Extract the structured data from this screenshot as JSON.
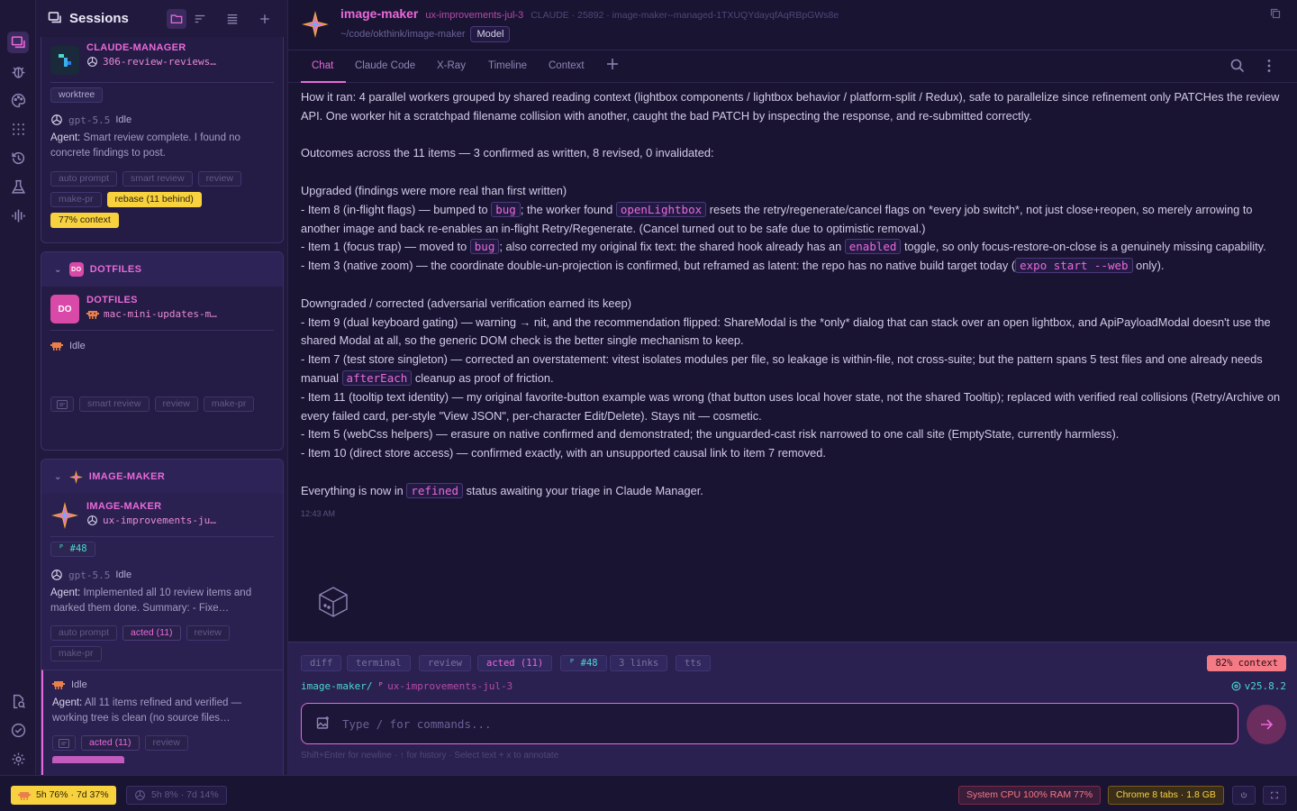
{
  "sidebar": {
    "title": "Sessions",
    "group_partial": {
      "project": "CLAUDE-MANAGER",
      "branch": "306-review-reviews…",
      "tag": "worktree",
      "model": "gpt-5.5",
      "status": "Idle",
      "agent_label": "Agent:",
      "agent_text": "Smart review complete. I found no concrete findings to post.",
      "chips": [
        "auto prompt",
        "smart review",
        "review",
        "make-pr"
      ],
      "rebase": "rebase (11 behind)",
      "context": "77% context"
    },
    "group_dotfiles": {
      "header": "DOTFILES",
      "badge": "DO",
      "project": "DOTFILES",
      "branch": "mac-mini-updates-m…",
      "status": "Idle",
      "chips": [
        "smart review",
        "review",
        "make-pr"
      ]
    },
    "group_image": {
      "header": "IMAGE-MAKER",
      "project": "IMAGE-MAKER",
      "branch": "ux-improvements-ju…",
      "pr": "#48",
      "model": "gpt-5.5",
      "status": "Idle",
      "agent_label": "Agent:",
      "agent_text": "Implemented all 10 review items and marked them done. Summary: - Fixe…",
      "chips": [
        "auto prompt",
        "acted (11)",
        "review",
        "make-pr"
      ],
      "sub_status": "Idle",
      "sub_agent_label": "Agent:",
      "sub_agent_text": "All 11 items refined and verified — working tree is clean (no source files…",
      "sub_chips": [
        "acted (11)",
        "review"
      ]
    }
  },
  "header": {
    "app": "image-maker",
    "branch": "ux-improvements-jul-3",
    "meta": "CLAUDE · 25892 · image-maker--managed-1TXUQYdayqfAqRBpGWs8e",
    "path": "~/code/okthink/image-maker",
    "model_button": "Model"
  },
  "tabs": [
    "Chat",
    "Claude Code",
    "X-Ray",
    "Timeline",
    "Context"
  ],
  "chat": {
    "p1": "How it ran: 4 parallel workers grouped by shared reading context (lightbox components / lightbox behavior / platform-split / Redux), safe to parallelize since refinement only PATCHes the review API. One worker hit a scratchpad filename collision with another, caught the bad PATCH by inspecting the response, and re-submitted correctly.",
    "p2": "Outcomes across the 11 items — 3 confirmed as written, 8 revised, 0 invalidated:",
    "up_title": "Upgraded (findings were more real than first written)",
    "i8_a": "- Item 8 (in-flight flags) — bumped to",
    "i8_code1": "bug",
    "i8_b": "; the worker found",
    "i8_code2": "openLightbox",
    "i8_c": "resets the retry/regenerate/cancel flags on *every job switch*, not just close+reopen, so merely arrowing to another image and back re-enables an in-flight Retry/Regenerate. (Cancel turned out to be safe due to optimistic removal.)",
    "i1_a": "- Item 1 (focus trap) — moved to",
    "i1_code1": "bug",
    "i1_b": "; also corrected my original fix text: the shared hook already has an",
    "i1_code2": "enabled",
    "i1_c": "toggle, so only focus-restore-on-close is a genuinely missing capability.",
    "i3_a": "- Item 3 (native zoom) — the coordinate double-un-projection is confirmed, but reframed as latent: the repo has no native build target today (",
    "i3_code": "expo start --web",
    "i3_b": "only).",
    "down_title": "Downgraded / corrected (adversarial verification earned its keep)",
    "i9": "- Item 9 (dual keyboard gating) — warning → nit, and the recommendation flipped: ShareModal is the *only* dialog that can stack over an open lightbox, and ApiPayloadModal doesn't use the shared Modal at all, so the generic DOM check is the better single mechanism to keep.",
    "i7_a": "- Item 7 (test store singleton) — corrected an overstatement: vitest isolates modules per file, so leakage is within-file, not cross-suite; but the pattern spans 5 test files and one already needs manual",
    "i7_code": "afterEach",
    "i7_b": "cleanup as proof of friction.",
    "i11": "- Item 11 (tooltip text identity) — my original favorite-button example was wrong (that button uses local hover state, not the shared Tooltip); replaced with verified real collisions (Retry/Archive on every failed card, per-style \"View JSON\", per-character Edit/Delete). Stays nit — cosmetic.",
    "i5": "- Item 5 (webCss helpers) — erasure on native confirmed and demonstrated; the unguarded-cast risk narrowed to one call site (EmptyState, currently harmless).",
    "i10": "- Item 10 (direct store access) — confirmed exactly, with an unsupported causal link to item 7 removed.",
    "final_a": "Everything is now in",
    "final_code": "refined",
    "final_b": "status awaiting your triage in Claude Manager.",
    "timestamp": "12:43 AM"
  },
  "composer": {
    "chips": [
      "diff",
      "terminal",
      "review",
      "acted (11)",
      "#48",
      "3 links",
      "tts"
    ],
    "context": "82% context",
    "path_repo": "image-maker/",
    "path_branch": "ux-improvements-jul-3",
    "version": "v25.8.2",
    "placeholder": "Type / for commands...",
    "hint": "Shift+Enter for newline · ↑ for history · Select text + x to annotate"
  },
  "bottombar": {
    "claude_usage": "5h 76% · 7d 37%",
    "gpt_usage": "5h 8% · 7d 14%",
    "system": "System CPU 100% RAM 77%",
    "chrome": "Chrome 8 tabs · 1.8 GB"
  },
  "colors": {
    "accent": "#e86ad8",
    "background": "#1a1433",
    "warning": "#f7d23e",
    "danger": "#f47a86"
  }
}
